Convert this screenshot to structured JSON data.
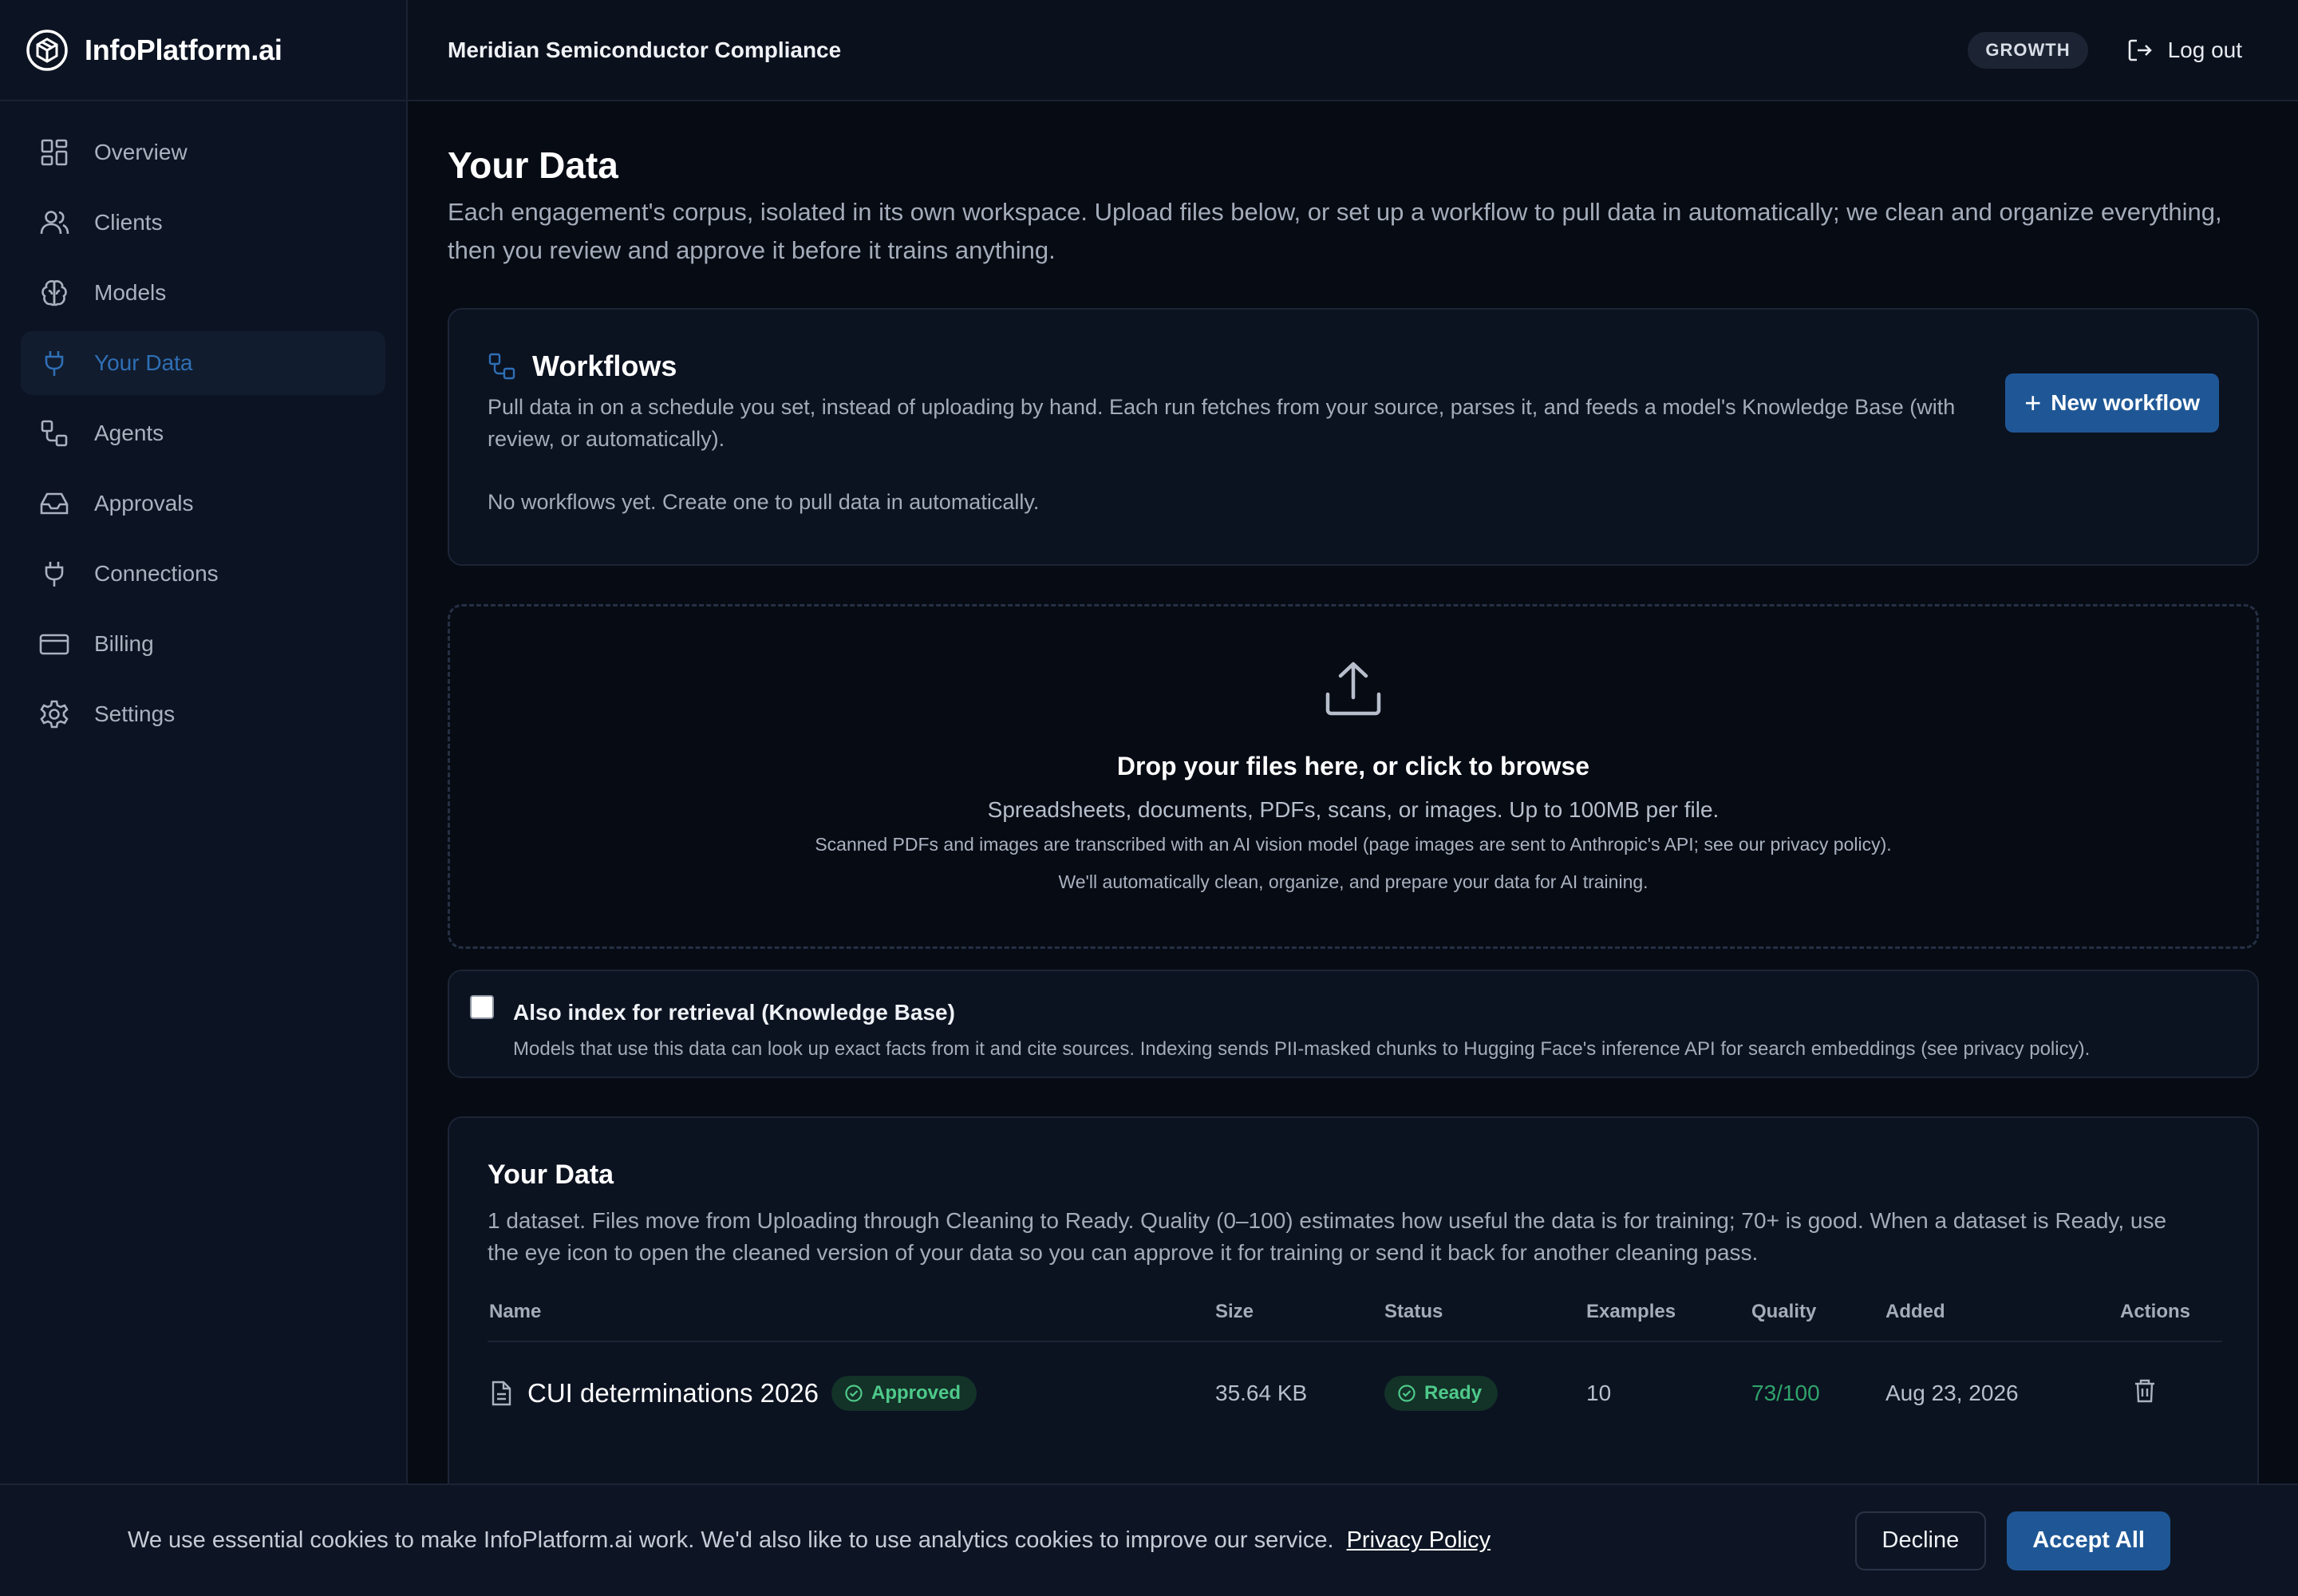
{
  "brand": {
    "name": "InfoPlatform.ai"
  },
  "sidebar": {
    "items": [
      {
        "label": "Overview",
        "icon": "grid-icon"
      },
      {
        "label": "Clients",
        "icon": "users-icon"
      },
      {
        "label": "Models",
        "icon": "brain-icon"
      },
      {
        "label": "Your Data",
        "icon": "plug-icon",
        "active": true
      },
      {
        "label": "Agents",
        "icon": "workflow-icon"
      },
      {
        "label": "Approvals",
        "icon": "inbox-icon"
      },
      {
        "label": "Connections",
        "icon": "plug-icon"
      },
      {
        "label": "Billing",
        "icon": "credit-card-icon"
      },
      {
        "label": "Settings",
        "icon": "gear-icon"
      }
    ]
  },
  "header": {
    "org_name": "Meridian Semiconductor Compliance",
    "plan": "GROWTH",
    "logout_label": "Log out"
  },
  "page": {
    "title": "Your Data",
    "description": "Each engagement's corpus, isolated in its own workspace. Upload files below, or set up a workflow to pull data in automatically; we clean and organize everything, then you review and approve it before it trains anything."
  },
  "workflows": {
    "title": "Workflows",
    "description": "Pull data in on a schedule you set, instead of uploading by hand. Each run fetches from your source, parses it, and feeds a model's Knowledge Base (with review, or automatically).",
    "empty": "No workflows yet. Create one to pull data in automatically.",
    "new_button": "New workflow"
  },
  "dropzone": {
    "title": "Drop your files here, or click to browse",
    "subtitle": "Spreadsheets, documents, PDFs, scans, or images. Up to 100MB per file.",
    "note1": "Scanned PDFs and images are transcribed with an AI vision model (page images are sent to Anthropic's API; see our privacy policy).",
    "note2": "We'll automatically clean, organize, and prepare your data for AI training."
  },
  "index_option": {
    "label": "Also index for retrieval (Knowledge Base)",
    "description": "Models that use this data can look up exact facts from it and cite sources. Indexing sends PII-masked chunks to Hugging Face's inference API for search embeddings (see privacy policy).",
    "checked": false
  },
  "datasets": {
    "title": "Your Data",
    "description": "1 dataset. Files move from Uploading through Cleaning to Ready. Quality (0–100) estimates how useful the data is for training; 70+ is good. When a dataset is Ready, use the eye icon to open the cleaned version of your data so you can approve it for training or send it back for another cleaning pass.",
    "columns": [
      "Name",
      "Size",
      "Status",
      "Examples",
      "Quality",
      "Added",
      "Actions"
    ],
    "rows": [
      {
        "name": "CUI determinations 2026",
        "badge": "Approved",
        "size": "35.64 KB",
        "status": "Ready",
        "examples": "10",
        "quality": "73/100",
        "added": "Aug 23, 2026"
      }
    ]
  },
  "cookie": {
    "text": "We use essential cookies to make InfoPlatform.ai work. We'd also like to use analytics cookies to improve our service.",
    "privacy_link": "Privacy Policy",
    "decline": "Decline",
    "accept": "Accept All"
  },
  "colors": {
    "accent": "#1f5796",
    "active_nav": "#2f6fb5",
    "success": "#4ec98a",
    "background": "#070b14"
  }
}
